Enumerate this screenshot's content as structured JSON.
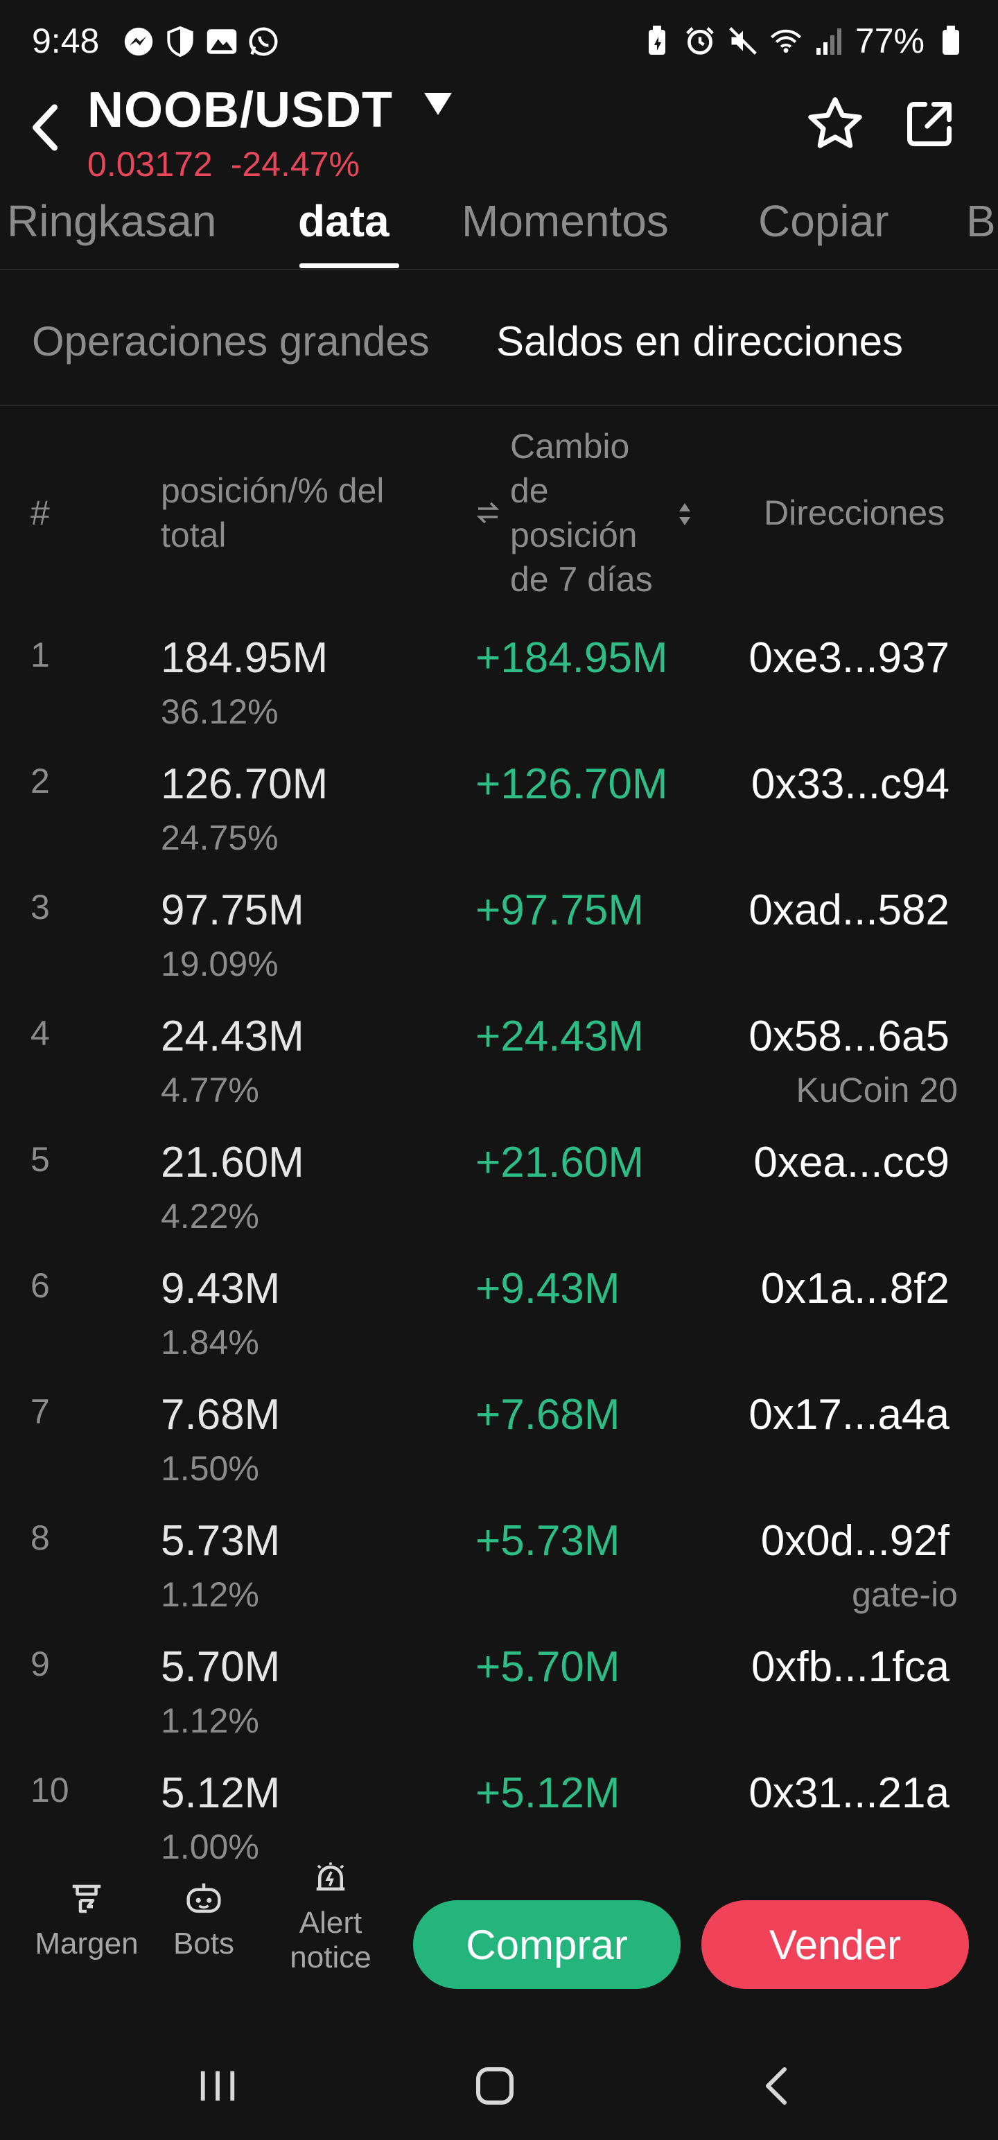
{
  "status_bar": {
    "time": "9:48",
    "battery": "77%",
    "left_icons": [
      "messenger-icon",
      "shield-icon",
      "gallery-icon",
      "whatsapp-icon"
    ],
    "right_icons": [
      "battery-saver-icon",
      "alarm-icon",
      "mute-icon",
      "wifi-icon",
      "signal-icon",
      "battery-icon"
    ]
  },
  "header": {
    "pair": "NOOB/USDT",
    "price": "0.03172",
    "change": "-24.47%"
  },
  "main_tabs": [
    "Ringkasan",
    "data",
    "Momentos",
    "Copiar",
    "B"
  ],
  "active_main_tab": "data",
  "sub_tabs": [
    "Operaciones grandes",
    "Saldos en direcciones"
  ],
  "active_sub_tab": "Saldos en direcciones",
  "table": {
    "headers": {
      "rank": "#",
      "position": [
        "posición/% del",
        "total"
      ],
      "change": [
        "Cambio",
        "de",
        "posición",
        "de 7 días"
      ],
      "address": "Direcciones"
    },
    "rows": [
      {
        "rank": "1",
        "position": "184.95M",
        "percent": "36.12%",
        "change": "+184.95M",
        "address": "0xe3...937",
        "label": ""
      },
      {
        "rank": "2",
        "position": "126.70M",
        "percent": "24.75%",
        "change": "+126.70M",
        "address": "0x33...c94",
        "label": ""
      },
      {
        "rank": "3",
        "position": "97.75M",
        "percent": "19.09%",
        "change": "+97.75M",
        "address": "0xad...582",
        "label": ""
      },
      {
        "rank": "4",
        "position": "24.43M",
        "percent": "4.77%",
        "change": "+24.43M",
        "address": "0x58...6a5",
        "label": "KuCoin 20"
      },
      {
        "rank": "5",
        "position": "21.60M",
        "percent": "4.22%",
        "change": "+21.60M",
        "address": "0xea...cc9",
        "label": ""
      },
      {
        "rank": "6",
        "position": "9.43M",
        "percent": "1.84%",
        "change": "+9.43M",
        "address": "0x1a...8f2",
        "label": ""
      },
      {
        "rank": "7",
        "position": "7.68M",
        "percent": "1.50%",
        "change": "+7.68M",
        "address": "0x17...a4a",
        "label": ""
      },
      {
        "rank": "8",
        "position": "5.73M",
        "percent": "1.12%",
        "change": "+5.73M",
        "address": "0x0d...92f",
        "label": "gate-io"
      },
      {
        "rank": "9",
        "position": "5.70M",
        "percent": "1.12%",
        "change": "+5.70M",
        "address": "0xfb...1fca",
        "label": ""
      },
      {
        "rank": "10",
        "position": "5.12M",
        "percent": "1.00%",
        "change": "+5.12M",
        "address": "0x31...21a",
        "label": ""
      }
    ]
  },
  "actions": {
    "margin": "Margen",
    "bots": "Bots",
    "alert_line1": "Alert",
    "alert_line2": "notice",
    "buy": "Comprar",
    "sell": "Vender"
  },
  "colors": {
    "background": "#141414",
    "positive": "#2ebd85",
    "negative": "#e8475a",
    "buy_button": "#24b57d",
    "sell_button": "#f0435a"
  }
}
